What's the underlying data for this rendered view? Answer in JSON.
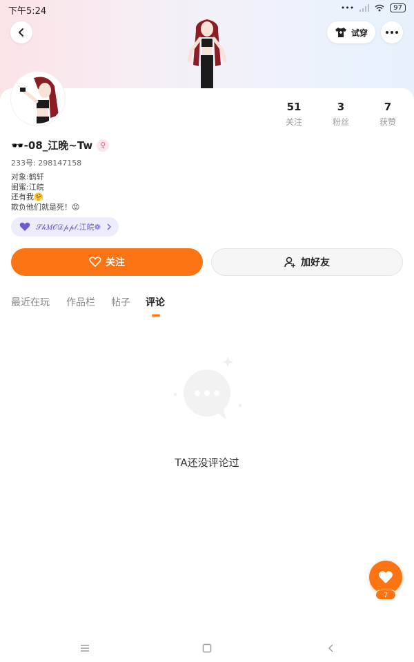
{
  "status_bar": {
    "time": "下午5:24",
    "signal": "•••",
    "battery": "97"
  },
  "header": {
    "tryon_label": "试穿"
  },
  "stats": [
    {
      "value": "51",
      "label": "关注"
    },
    {
      "value": "3",
      "label": "粉丝"
    },
    {
      "value": "7",
      "label": "获赞"
    }
  ],
  "profile": {
    "username": "🕶️-08_江晚~Tw",
    "gender_symbol": "♀",
    "user_id": "233号: 298147158",
    "bio_lines": [
      "对象:鹤轩",
      "闺蜜:江皖",
      "还有我🤗",
      "欺负他们就是死！😡"
    ],
    "guild_tag": "𝒮𝒽𝑀𝒪𝒟𝓅𝓅𝓁.江皖❁"
  },
  "actions": {
    "follow_label": "关注",
    "add_friend_label": "加好友"
  },
  "tabs": [
    {
      "label": "最近在玩",
      "active": false
    },
    {
      "label": "作品栏",
      "active": false
    },
    {
      "label": "帖子",
      "active": false
    },
    {
      "label": "评论",
      "active": true
    }
  ],
  "empty_state": {
    "message": "TA还没评论过"
  },
  "like": {
    "count": "7"
  },
  "colors": {
    "accent": "#fb7413",
    "guild": "#6a5fcc"
  }
}
